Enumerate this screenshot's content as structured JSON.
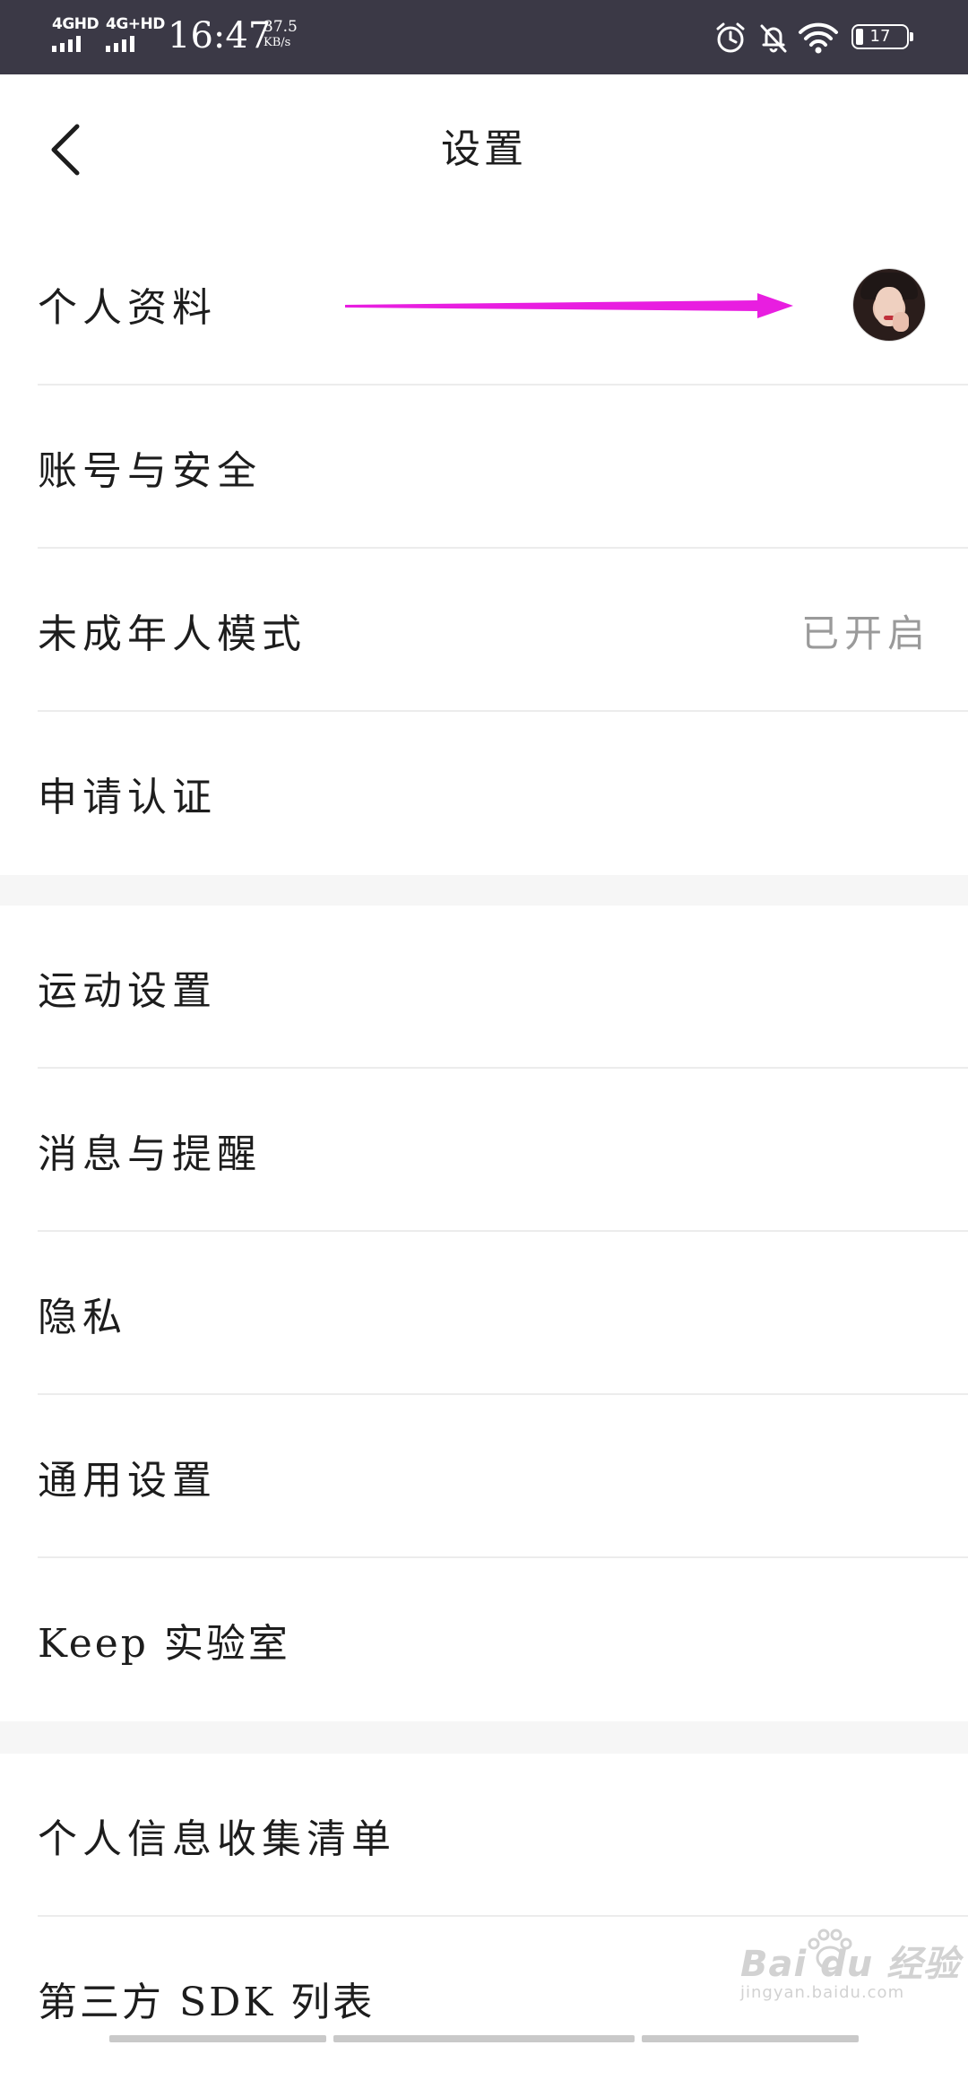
{
  "status_bar": {
    "signal1": "4GHD",
    "signal2": "4G+HD",
    "time": "16:47",
    "speed_value": "37.5",
    "speed_unit": "KB/s",
    "battery": "17",
    "icons": [
      "alarm-icon",
      "bell-off-icon",
      "wifi-icon",
      "battery-icon"
    ]
  },
  "header": {
    "title": "设置",
    "back_icon": "chevron-left-icon"
  },
  "sections": [
    {
      "items": [
        {
          "label": "个人资料",
          "trailing": "avatar"
        },
        {
          "label": "账号与安全"
        },
        {
          "label": "未成年人模式",
          "value": "已开启"
        },
        {
          "label": "申请认证"
        }
      ]
    },
    {
      "items": [
        {
          "label": "运动设置"
        },
        {
          "label": "消息与提醒"
        },
        {
          "label": "隐私"
        },
        {
          "label": "通用设置"
        },
        {
          "label": "Keep 实验室"
        }
      ]
    },
    {
      "items": [
        {
          "label": "个人信息收集清单"
        },
        {
          "label": "第三方 SDK 列表"
        }
      ]
    }
  ],
  "annotation": {
    "arrow_color": "#e81ee0"
  },
  "watermark": {
    "brand": "Bai du 经验",
    "site": "jingyan.baidu.com"
  },
  "colors": {
    "status_bar_bg": "#3b3946",
    "value_text": "#9a9a9a",
    "section_gap": "#f6f6f6"
  }
}
